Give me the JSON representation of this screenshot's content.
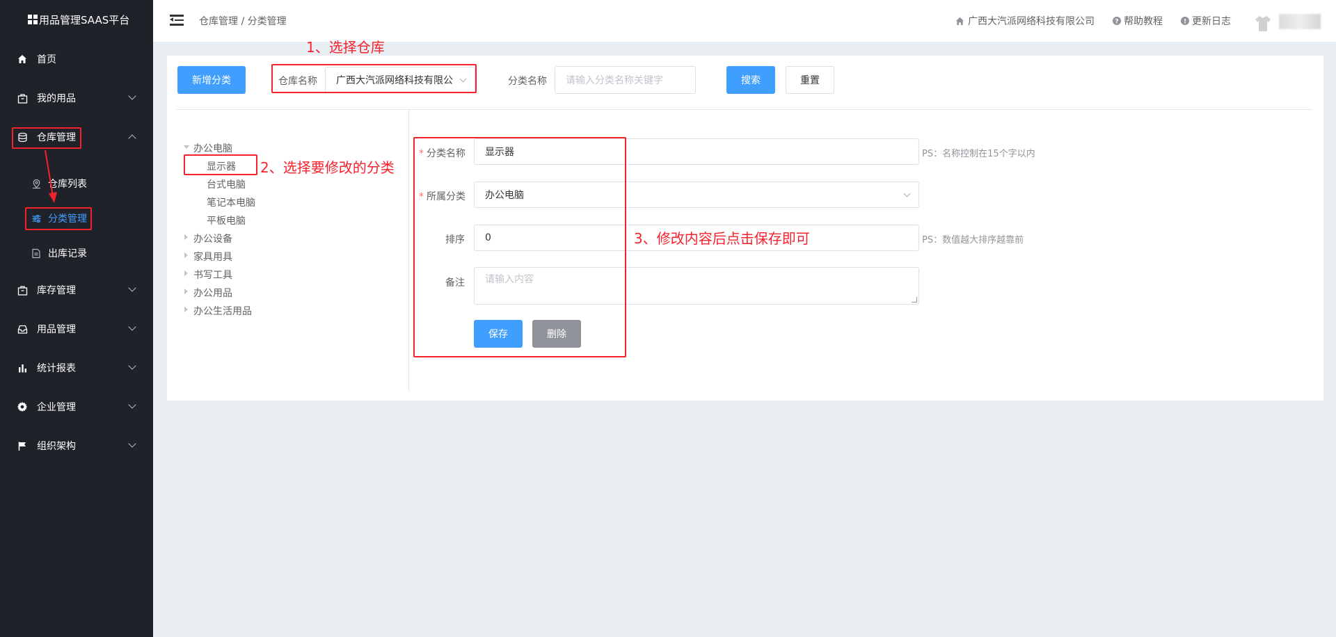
{
  "app": {
    "title": "用品管理SAAS平台"
  },
  "sidebar": {
    "items": [
      {
        "label": "首页",
        "icon": "home-icon"
      },
      {
        "label": "我的用品",
        "icon": "bag-icon"
      },
      {
        "label": "仓库管理",
        "icon": "database-icon"
      },
      {
        "label": "库存管理",
        "icon": "box-icon"
      },
      {
        "label": "用品管理",
        "icon": "inbox-icon"
      },
      {
        "label": "统计报表",
        "icon": "bar-chart-icon"
      },
      {
        "label": "企业管理",
        "icon": "gear-icon"
      },
      {
        "label": "组织架构",
        "icon": "flag-icon"
      }
    ],
    "warehouse_sub": [
      {
        "label": "仓库列表",
        "icon": "location-icon"
      },
      {
        "label": "分类管理",
        "icon": "sliders-icon"
      },
      {
        "label": "出库记录",
        "icon": "document-icon"
      }
    ]
  },
  "header": {
    "breadcrumb": "仓库管理 / 分类管理",
    "company": "广西大汽派网络科技有限公司",
    "help": "帮助教程",
    "changelog": "更新日志"
  },
  "toolbar": {
    "add_button": "新增分类",
    "warehouse_label": "仓库名称",
    "warehouse_value": "广西大汽派网络科技有限公",
    "category_label": "分类名称",
    "category_placeholder": "请输入分类名称关键字",
    "search_button": "搜索",
    "reset_button": "重置"
  },
  "tree": {
    "nodes": [
      {
        "label": "办公电脑",
        "expanded": true,
        "children": [
          "显示器",
          "台式电脑",
          "笔记本电脑",
          "平板电脑"
        ]
      },
      {
        "label": "办公设备"
      },
      {
        "label": "家具用具"
      },
      {
        "label": "书写工具"
      },
      {
        "label": "办公用品"
      },
      {
        "label": "办公生活用品"
      }
    ]
  },
  "form": {
    "name_label": "分类名称",
    "name_value": "显示器",
    "name_hint": "PS：名称控制在15个字以内",
    "parent_label": "所属分类",
    "parent_value": "办公电脑",
    "sort_label": "排序",
    "sort_value": "0",
    "sort_hint": "PS：数值越大排序越靠前",
    "remark_label": "备注",
    "remark_placeholder": "请输入内容",
    "save_button": "保存",
    "delete_button": "删除"
  },
  "annotations": {
    "step1": "1、选择仓库",
    "step2": "2、选择要修改的分类",
    "step3": "3、修改内容后点击保存即可"
  },
  "colors": {
    "sidebar_bg": "#20222a",
    "primary": "#409eff",
    "annotation": "#f5222d"
  }
}
